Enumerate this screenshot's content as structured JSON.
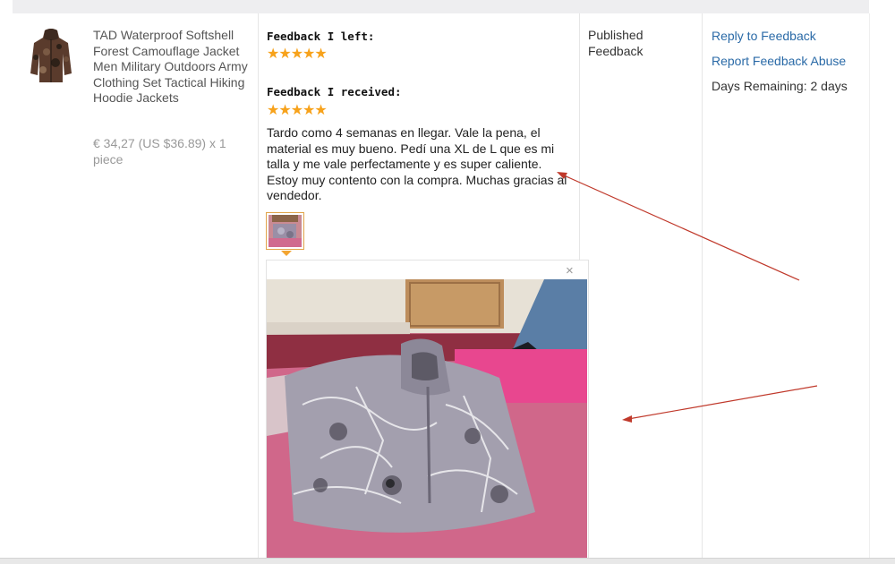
{
  "product": {
    "title": "TAD Waterproof Softshell Forest Camouflage Jacket Men Military Outdoors Army Clothing Set Tactical Hiking Hoodie Jackets",
    "price": "€ 34,27 (US $36.89) x 1 piece"
  },
  "feedback": {
    "left_label": "Feedback I left:",
    "left_rating": "★★★★★",
    "received_label": "Feedback I received:",
    "received_rating": "★★★★★",
    "review_text": "Tardo como 4 semanas en llegar. Vale la pena, el material es muy bueno. Pedí una XL de L que es mi talla y me vale perfectamente y es super caliente. Estoy muy contento con la compra. Muchas gracias al vendedor.",
    "close_glyph": "×"
  },
  "status": {
    "text": "Published Feedback"
  },
  "actions": {
    "reply": "Reply to Feedback",
    "report": "Report Feedback Abuse",
    "days_remaining": "Days Remaining: 2 days"
  },
  "colors": {
    "star": "#f7a21b",
    "link": "#2a6aa7",
    "arrow": "#c0392b"
  }
}
